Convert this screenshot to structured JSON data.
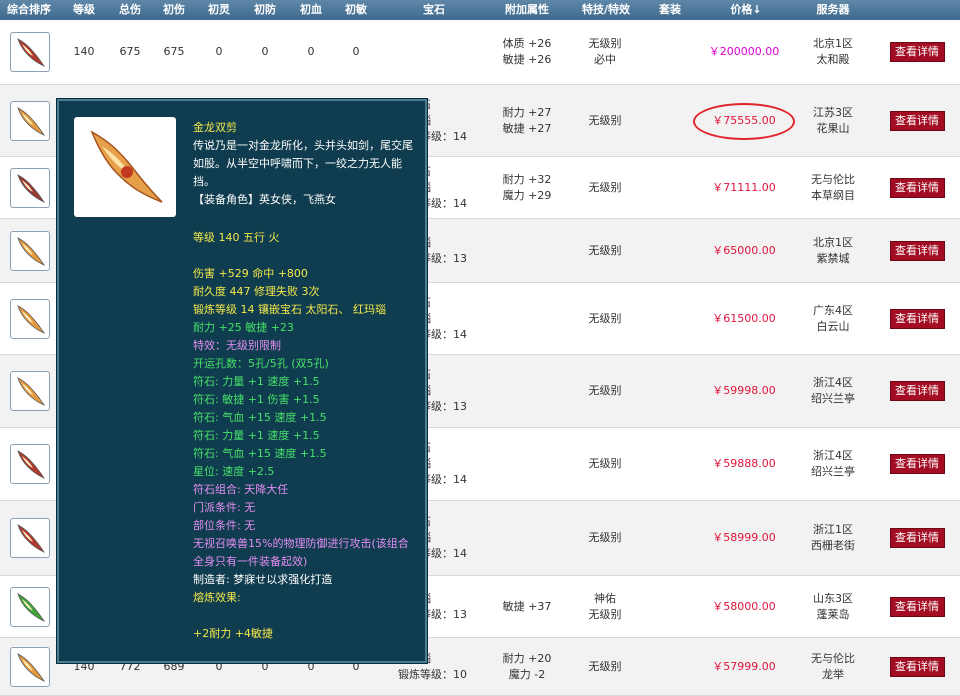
{
  "headers": {
    "rank": "综合排序",
    "level": "等级",
    "total_dmg": "总伤",
    "base_dmg": "初伤",
    "base_spirit": "初灵",
    "base_def": "初防",
    "base_hp": "初血",
    "base_agi": "初敏",
    "gem": "宝石",
    "attr": "附加属性",
    "skill": "特技/特效",
    "set": "套装",
    "price": "价格",
    "price_arrow": "↓",
    "server": "服务器"
  },
  "rows": [
    {
      "level": "140",
      "total": "675",
      "dmg": "675",
      "spirit": "0",
      "def": "0",
      "hp": "0",
      "agi": "0",
      "gem1": "",
      "gem2": "",
      "attr1": "体质 +26",
      "attr2": "敏捷 +26",
      "skill1": "无级别",
      "skill2": "必中",
      "price": "￥200000.00",
      "server1": "北京1区",
      "server2": "太和殿",
      "btn": "查看详情"
    },
    {
      "gem1": "太阳石",
      "gem2": "红玛瑙",
      "gem3": "锻炼等级：14",
      "attr1": "耐力 +27",
      "attr2": "敏捷 +27",
      "skill1": "无级别",
      "price": "￥75555.00",
      "server1": "江苏3区",
      "server2": "花果山",
      "btn": "查看详情"
    },
    {
      "gem1": "太阳石",
      "gem2": "红玛瑙",
      "gem3": "锻炼等级：14",
      "attr1": "耐力 +32",
      "attr2": "魔力 +29",
      "skill1": "无级别",
      "price": "￥71111.00",
      "server1": "无与伦比",
      "server2": "本草纲目",
      "btn": "查看详情"
    },
    {
      "gem1": "红玛瑙",
      "gem3": "锻炼等级：13",
      "skill1": "无级别",
      "price": "￥65000.00",
      "server1": "北京1区",
      "server2": "紫禁城",
      "btn": "查看详情"
    },
    {
      "gem1": "太阳石",
      "gem2": "红玛瑙",
      "gem3": "锻炼等级：14",
      "skill1": "无级别",
      "price": "￥61500.00",
      "server1": "广东4区",
      "server2": "白云山",
      "btn": "查看详情"
    },
    {
      "gem1": "太阳石",
      "gem2": "红玛瑙",
      "gem3": "锻炼等级：13",
      "skill1": "无级别",
      "price": "￥59998.00",
      "server1": "浙江4区",
      "server2": "绍兴兰亭",
      "btn": "查看详情"
    },
    {
      "gem1": "太阳石",
      "gem2": "红玛瑙",
      "gem3": "锻炼等级：14",
      "skill1": "无级别",
      "price": "￥59888.00",
      "server1": "浙江4区",
      "server2": "绍兴兰亭",
      "btn": "查看详情"
    },
    {
      "gem1": "太阳石",
      "gem2": "红玛瑙",
      "gem3": "锻炼等级：14",
      "skill1": "无级别",
      "price": "￥58999.00",
      "server1": "浙江1区",
      "server2": "西栅老街",
      "btn": "查看详情"
    },
    {
      "gem1": "红玛瑙",
      "gem3": "锻炼等级：13",
      "attr1": "敏捷 +37",
      "skill1": "神佑",
      "skill2": "无级别",
      "price": "￥58000.00",
      "server1": "山东3区",
      "server2": "蓬莱岛",
      "btn": "查看详情"
    },
    {
      "level": "140",
      "total": "772",
      "dmg": "689",
      "spirit": "0",
      "def": "0",
      "hp": "0",
      "agi": "0",
      "gem1": "红玛瑙",
      "gem3": "锻炼等级：10",
      "attr1": "耐力 +20",
      "attr2": "魔力 -2",
      "skill1": "无级别",
      "price": "￥57999.00",
      "server1": "无与伦比",
      "server2": "龙举",
      "btn": "查看详情"
    }
  ],
  "tooltip": {
    "name": "金龙双剪",
    "desc": "传说乃是一对金龙所化，头并头如剑，尾交尾如股。从半空中呼啸而下，一绞之力无人能挡。",
    "role": "【装备角色】英女侠，飞燕女",
    "level": "等级 140  五行 火",
    "l1": "伤害 +529  命中 +800",
    "l2": "耐久度 447  修理失败 3次",
    "l3": "锻炼等级 14  镶嵌宝石 太阳石、 红玛瑙",
    "l4": "耐力 +25  敏捷 +23",
    "l5": "特效：无级别限制",
    "l6": "开运孔数：5孔/5孔 (双5孔)",
    "l7": "符石: 力量 +1  速度 +1.5",
    "l8": "符石: 敏捷 +1  伤害 +1.5",
    "l9": "符石: 气血 +15  速度 +1.5",
    "l10": "符石: 力量 +1  速度 +1.5",
    "l11": "符石: 气血 +15  速度 +1.5",
    "l12": "星位: 速度 +2.5",
    "l13": "符石组合: 天降大任",
    "l14": "门派条件: 无",
    "l15": "部位条件: 无",
    "l16": "无视召唤兽15%的物理防御进行攻击(该组合全身只有一件装备起效)",
    "l17": "制造者: 梦寐せ以求强化打造",
    "l18": "熔炼效果:",
    "l19": "+2耐力  +4敏捷"
  }
}
